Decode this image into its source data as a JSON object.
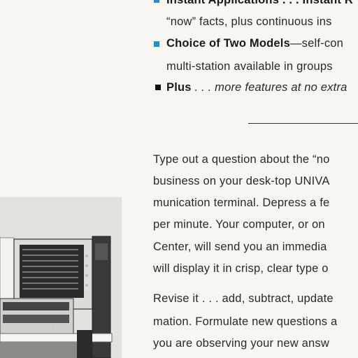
{
  "bullets": [
    {
      "head": "Instant Applications . . . Instant R",
      "body": ""
    },
    {
      "cont": "“now” facts, plus continuous ins"
    },
    {
      "head": "Choice of Two Models",
      "body": "—self-con"
    },
    {
      "cont": "multi-station available in groups"
    },
    {
      "head": "Plus",
      "body": " . . . more features at no extra"
    }
  ],
  "para1": [
    "Type out a question about the “no",
    "business on your desk-top UNIVA",
    "munication terminal. Depress a fe",
    "per minute. Your computer, or on",
    "Center, will send you an immedia",
    "will display it in crisp, clear type o"
  ],
  "para2": [
    "Revise it . . . add, subtract, update",
    "mation. Formulate new questions a",
    "you are observing your new answ"
  ],
  "photo_alt": "computer terminal equipment photo"
}
